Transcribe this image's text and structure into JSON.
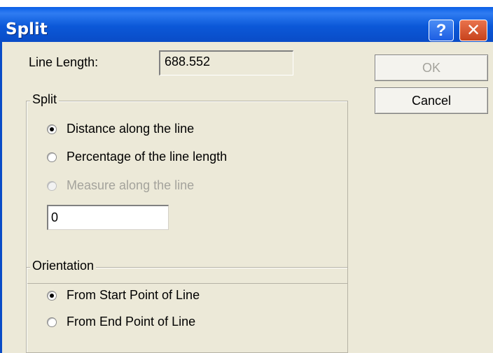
{
  "window": {
    "title": "Split",
    "help_glyph": "?",
    "close_glyph": "✕"
  },
  "line_length": {
    "label": "Line Length:",
    "value": "688.552"
  },
  "buttons": {
    "ok": "OK",
    "cancel": "Cancel"
  },
  "split_group": {
    "legend": "Split",
    "options": [
      {
        "label": "Distance along the line",
        "checked": true,
        "disabled": false
      },
      {
        "label": "Percentage of the line length",
        "checked": false,
        "disabled": false
      },
      {
        "label": "Measure along the line",
        "checked": false,
        "disabled": true
      }
    ],
    "input_value": "0"
  },
  "orientation_group": {
    "legend": "Orientation",
    "options": [
      {
        "label": "From Start Point of Line",
        "checked": true
      },
      {
        "label": "From End Point of Line",
        "checked": false
      }
    ]
  },
  "colors": {
    "title_bar": "#0a4cc7",
    "dialog_bg": "#ece9d8",
    "disabled_text": "#a4a39c"
  }
}
